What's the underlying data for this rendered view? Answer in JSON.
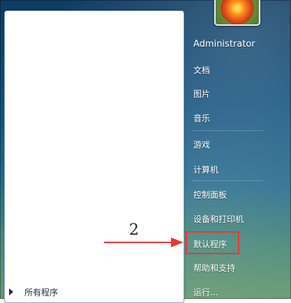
{
  "user": {
    "name": "Administrator"
  },
  "right_menu": [
    "文档",
    "图片",
    "音乐",
    "游戏",
    "计算机",
    "控制面板",
    "设备和打印机",
    "默认程序",
    "帮助和支持",
    "运行..."
  ],
  "left_menu": {
    "all_programs": "所有程序"
  },
  "annotation": {
    "number": "2"
  },
  "colors": {
    "highlight": "#e23a3a",
    "pane": "#ffffff",
    "text_on_glass": "#ffffff"
  }
}
